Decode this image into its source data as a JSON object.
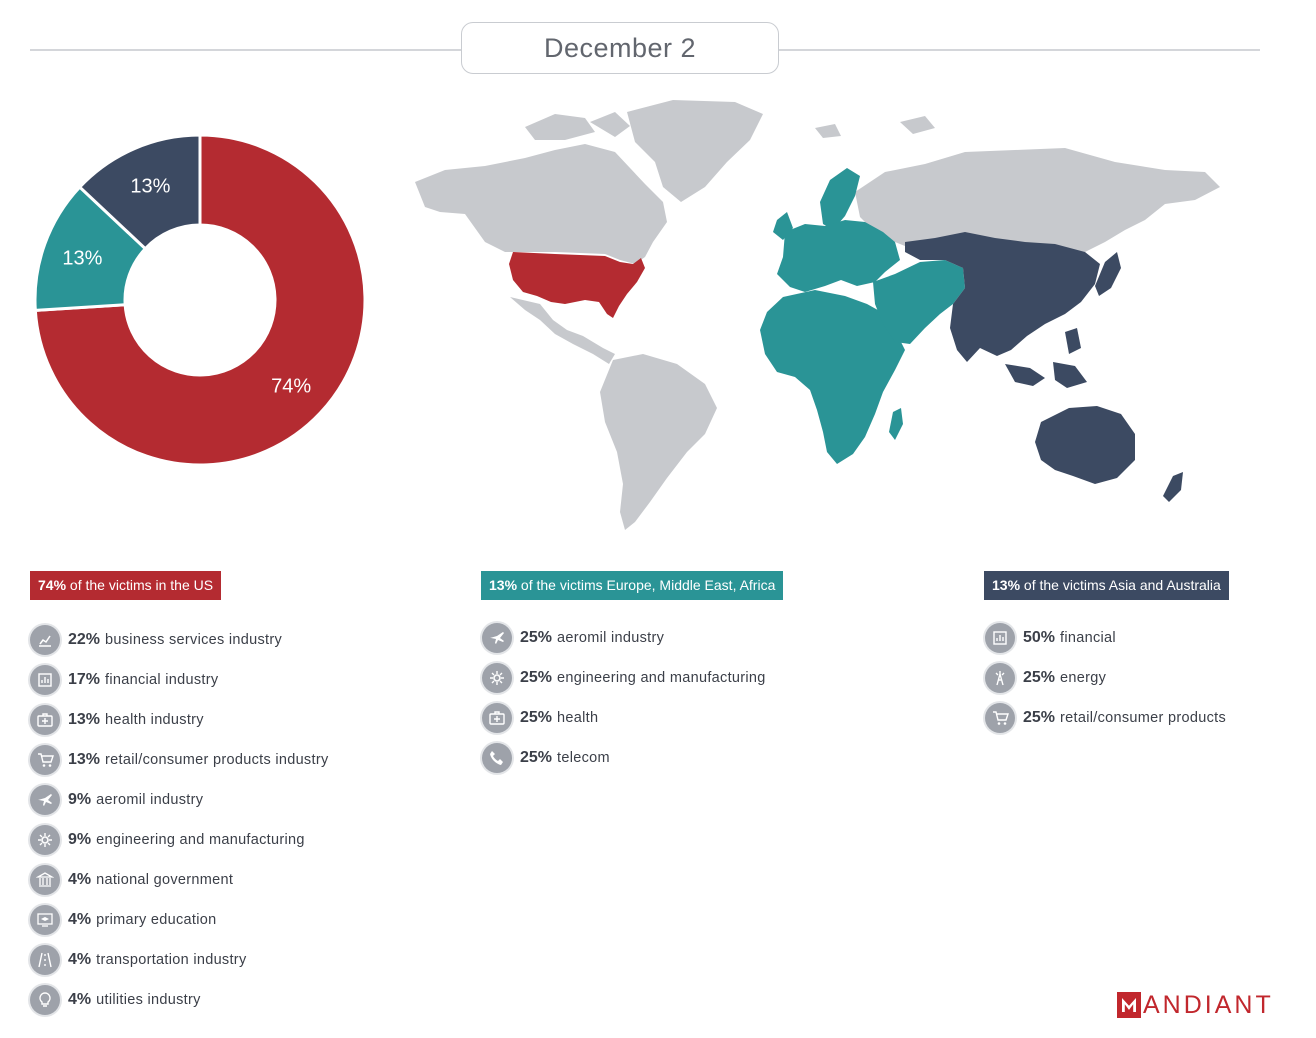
{
  "header": {
    "date": "December 2"
  },
  "colors": {
    "us": "#b42b31",
    "emea": "#2a9496",
    "apac": "#3c4a62",
    "other": "#c7c9cd"
  },
  "chart_data": [
    {
      "type": "pie",
      "title": "",
      "categories": [
        "US",
        "Europe, Middle East, Africa",
        "Asia and Australia"
      ],
      "values": [
        74,
        13,
        13
      ],
      "labels": [
        "74%",
        "13%",
        "13%"
      ],
      "colors": [
        "#b42b31",
        "#2a9496",
        "#3c4a62"
      ],
      "donut": true
    }
  ],
  "map": {
    "regions": [
      {
        "name": "United States",
        "share": 74
      },
      {
        "name": "Europe, Middle East, Africa",
        "share": 13
      },
      {
        "name": "Asia and Australia",
        "share": 13
      }
    ]
  },
  "sections": [
    {
      "tag_pct": "74%",
      "tag_text": "of the victims in the US",
      "items": [
        {
          "pct": "22%",
          "label": "business services industry",
          "icon": "chart-icon"
        },
        {
          "pct": "17%",
          "label": "financial industry",
          "icon": "finance-icon"
        },
        {
          "pct": "13%",
          "label": "health industry",
          "icon": "medkit-icon"
        },
        {
          "pct": "13%",
          "label": "retail/consumer products industry",
          "icon": "cart-icon"
        },
        {
          "pct": "9%",
          "label": "aeromil industry",
          "icon": "jet-icon"
        },
        {
          "pct": "9%",
          "label": "engineering and manufacturing",
          "icon": "gear-icon"
        },
        {
          "pct": "4%",
          "label": "national government",
          "icon": "government-icon"
        },
        {
          "pct": "4%",
          "label": "primary education",
          "icon": "education-icon"
        },
        {
          "pct": "4%",
          "label": "transportation industry",
          "icon": "road-icon"
        },
        {
          "pct": "4%",
          "label": "utilities industry",
          "icon": "bulb-icon"
        }
      ]
    },
    {
      "tag_pct": "13%",
      "tag_text": "of the victims Europe, Middle East, Africa",
      "items": [
        {
          "pct": "25%",
          "label": "aeromil industry",
          "icon": "jet-icon"
        },
        {
          "pct": "25%",
          "label": "engineering and manufacturing",
          "icon": "gear-icon"
        },
        {
          "pct": "25%",
          "label": "health",
          "icon": "medkit-icon"
        },
        {
          "pct": "25%",
          "label": "telecom",
          "icon": "phone-icon"
        }
      ]
    },
    {
      "tag_pct": "13%",
      "tag_text": "of the victims Asia and Australia",
      "items": [
        {
          "pct": "50%",
          "label": "financial",
          "icon": "finance-icon"
        },
        {
          "pct": "25%",
          "label": "energy",
          "icon": "tower-icon"
        },
        {
          "pct": "25%",
          "label": "retail/consumer products",
          "icon": "cart-icon"
        }
      ]
    }
  ],
  "logo": {
    "text": "ANDIANT"
  }
}
